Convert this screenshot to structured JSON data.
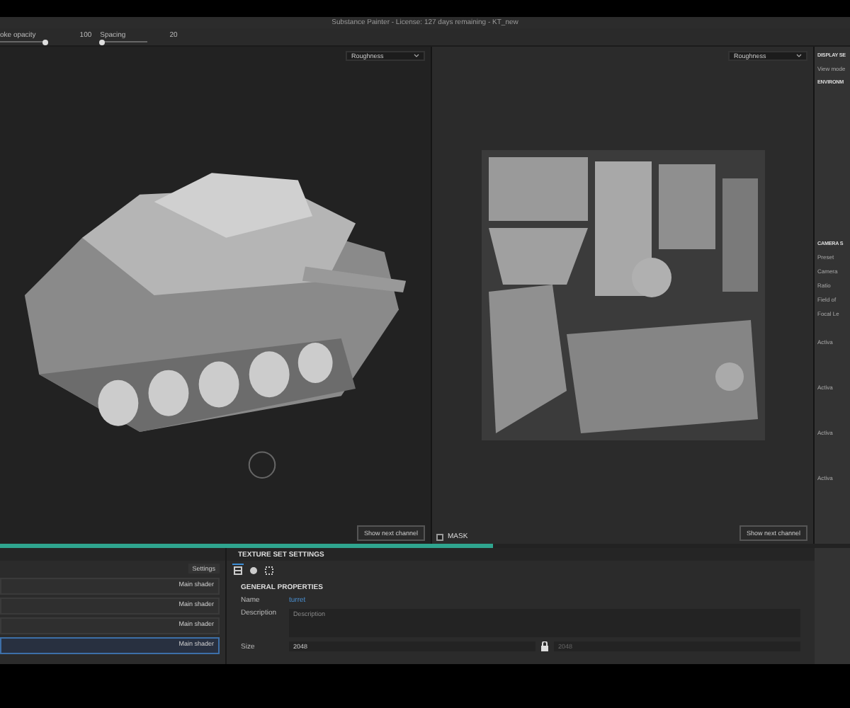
{
  "window": {
    "title": "Substance Painter - License: 127 days remaining - KT_new"
  },
  "toolbar": {
    "stroke_opacity": {
      "label": "oke opacity",
      "value": "100",
      "level": 0.97
    },
    "spacing": {
      "label": "Spacing",
      "value": "20",
      "level": 0.05
    }
  },
  "viewports": [
    {
      "channel": "Roughness",
      "button": "Show next channel",
      "kind": "model"
    },
    {
      "channel": "Roughness",
      "button": "Show next channel",
      "kind": "texture"
    }
  ],
  "mask": {
    "label": "MASK",
    "checked": false
  },
  "progress": {
    "level": 0.58
  },
  "layers": {
    "settings": "Settings",
    "rows": [
      {
        "shader": "Main shader",
        "selected": false
      },
      {
        "shader": "Main shader",
        "selected": false
      },
      {
        "shader": "Main shader",
        "selected": false
      },
      {
        "shader": "Main shader",
        "selected": true
      }
    ]
  },
  "texture_set": {
    "title": "TEXTURE SET SETTINGS",
    "tabs": [
      {
        "kind": "layout",
        "selected": true
      },
      {
        "kind": "material",
        "selected": false
      },
      {
        "kind": "bounds",
        "selected": false
      }
    ],
    "section": "GENERAL PROPERTIES",
    "name_label": "Name",
    "name_value": "turret",
    "description_label": "Description",
    "description_placeholder": "Description",
    "size_label": "Size",
    "size_value": "2048",
    "size_value_2": "2048"
  },
  "display_settings": {
    "title": "DISPLAY SE",
    "view_mode": "View mode",
    "environment": "ENVIRONM",
    "camera_title": "CAMERA S",
    "preset": "Preset",
    "camera": "Camera",
    "ratio": "Ratio",
    "field_of_view": "Field of",
    "focal_length": "Focal Le",
    "activate": [
      "Activa",
      "Activa",
      "Activa",
      "Activa"
    ]
  }
}
